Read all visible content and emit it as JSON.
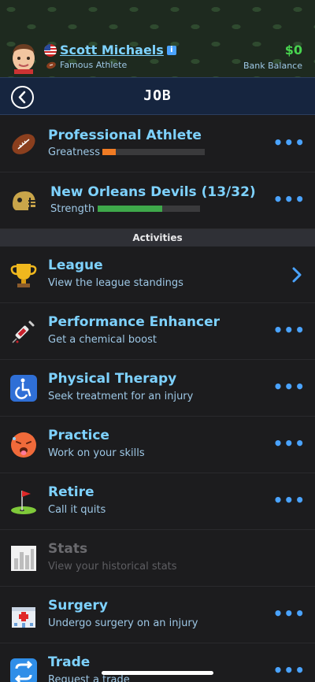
{
  "header": {
    "player_name": "Scott Michaels",
    "occupation": "Famous Athlete",
    "money": "$0",
    "money_label": "Bank Balance",
    "info_icon": "i"
  },
  "nav": {
    "title": "JOB"
  },
  "job": {
    "title": "Professional Athlete",
    "stat_label": "Greatness",
    "stat_level": 0.13,
    "stat_color": "#f07b24"
  },
  "team": {
    "title": "New Orleans Devils (13/32)",
    "stat_label": "Strength",
    "stat_level": 0.63,
    "stat_color": "#3ea84a"
  },
  "section": {
    "title": "Activities"
  },
  "activities": [
    {
      "title": "League",
      "subtitle": "View the league standings",
      "icon": "trophy-icon",
      "action": "chevron"
    },
    {
      "title": "Performance Enhancer",
      "subtitle": "Get a chemical boost",
      "icon": "syringe-icon",
      "action": "more"
    },
    {
      "title": "Physical Therapy",
      "subtitle": "Seek treatment for an injury",
      "icon": "wheelchair-icon",
      "action": "more"
    },
    {
      "title": "Practice",
      "subtitle": "Work on your skills",
      "icon": "exhausted-face-icon",
      "action": "more"
    },
    {
      "title": "Retire",
      "subtitle": "Call it quits",
      "icon": "golf-flag-icon",
      "action": "more"
    },
    {
      "title": "Stats",
      "subtitle": "View your historical stats",
      "icon": "stats-chart-icon",
      "action": "none"
    },
    {
      "title": "Surgery",
      "subtitle": "Undergo surgery on an injury",
      "icon": "hospital-icon",
      "action": "more"
    },
    {
      "title": "Trade",
      "subtitle": "Request a trade",
      "icon": "trade-arrows-icon",
      "action": "more"
    }
  ],
  "colors": {
    "accent": "#7ed2ff",
    "link": "#4aa3ff",
    "money": "#48d44f"
  }
}
